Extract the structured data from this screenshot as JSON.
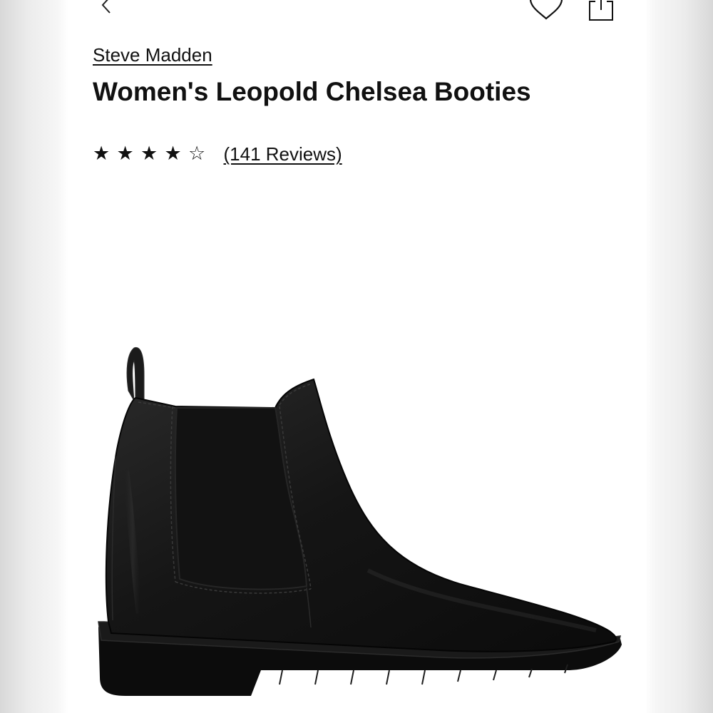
{
  "product": {
    "brand": "Steve Madden",
    "title": "Women's Leopold Chelsea Booties",
    "rating": 4,
    "rating_max": 5,
    "stars": [
      "★",
      "★",
      "★",
      "★",
      "☆"
    ],
    "reviews_label": "(141 Reviews)"
  },
  "icons": {
    "back": "chevron-left-icon",
    "favorite": "heart-icon",
    "share": "share-icon"
  },
  "colors": {
    "text": "#111111",
    "background": "#ffffff",
    "boot": "#141414"
  }
}
